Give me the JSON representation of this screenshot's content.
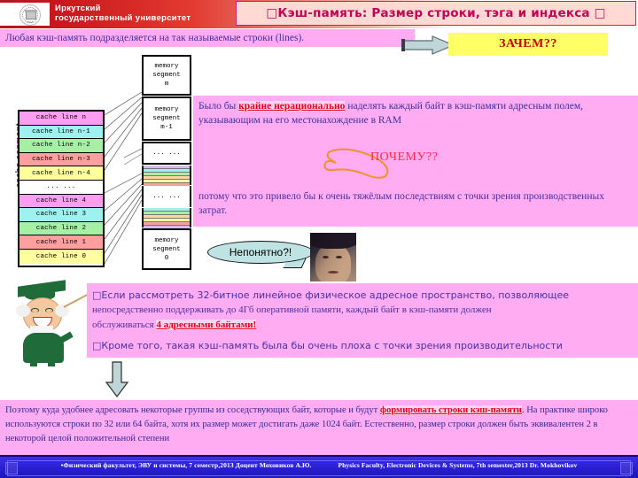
{
  "header": {
    "university_line1": "Иркутский",
    "university_line2": "государственный университет",
    "logo_year": "1918",
    "title": "□Кэш-память: Размер строки, тэга и индекса □"
  },
  "intro": {
    "text": "Любая кэш-память подразделяется на так называемые строки (lines)."
  },
  "callout_zachem": {
    "label": "ЗАЧЕМ??",
    "bg": "#ffff66",
    "fg": "#c0000a"
  },
  "cache_diagram": {
    "axis_label": "cache segment",
    "rows": [
      {
        "label": "cache line n",
        "color": "#ff9ef0"
      },
      {
        "label": "cache line n-1",
        "color": "#9ff1ef"
      },
      {
        "label": "cache line n-2",
        "color": "#a6f0a6"
      },
      {
        "label": "cache line n-3",
        "color": "#ff9f9f"
      },
      {
        "label": "cache line n-4",
        "color": "#ffff9e"
      },
      {
        "label": "... ...",
        "color": "#ffffff"
      },
      {
        "label": "cache line 4",
        "color": "#ff9ef0"
      },
      {
        "label": "cache line 3",
        "color": "#9ff1ef"
      },
      {
        "label": "cache line 2",
        "color": "#a6f0a6"
      },
      {
        "label": "cache line 1",
        "color": "#ff9f9f"
      },
      {
        "label": "cache line 0",
        "color": "#ffff9e"
      }
    ]
  },
  "memory_diagram": {
    "blocks": [
      {
        "lines": [
          "memory",
          "segment",
          "m"
        ]
      },
      {
        "lines": [
          "memory",
          "segment",
          "m-1"
        ]
      },
      {
        "lines": [
          "... ..."
        ]
      },
      {
        "lines": [
          "... ..."
        ]
      },
      {
        "lines": [
          "memory",
          "segment",
          "0"
        ]
      }
    ]
  },
  "para_irrational": {
    "before": "Было бы ",
    "highlight": "крайне нерационально",
    "after": " наделять каждый байт в кэш-памяти адресным полем, указывающим на его местонахождение в RAM"
  },
  "callout_why": {
    "label": "ПОЧЕМУ??",
    "color": "#ff2d4a"
  },
  "para_because": {
    "text": "потому что это привело бы к очень тяжёлым последствиям с точки зрения производственных затрат."
  },
  "callout_neponyatno": {
    "label": "Непонятно?!",
    "bg": "#bfe3e3"
  },
  "box3": {
    "line1": "□Если рассмотреть 32-битное линейное физическое адресное пространство, позволяющее",
    "line2": "непосредственно поддерживать до 4Гб оперативной памяти, каждый байт в кэш-памяти должен",
    "line3_before": "обслуживаться ",
    "line3_highlight": "4 адресными байтами!",
    "line4": "□Кроме того, такая кэш-память была бы очень плоха с точки зрения производительности"
  },
  "para_bottom": {
    "before": "Поэтому куда удобнее адресовать некоторые группы из соседствующих байт, которые и будут ",
    "highlight": "формировать строки кэш-памяти",
    "after": ". На практике широко используются строки по 32 или 64 байта, хотя их размер может достигать даже 1024 байт. Естественно, размер строки должен быть эквивалентен 2 в некоторой целой положительной степени"
  },
  "footer": {
    "left": "•Физический факультет, ЭВУ и системы, 7 семестр,2013 Доцент Моховиков А.Ю.",
    "right": "Physics Faculty, Electronic Devices & Systems, 7th semester,2013  Dr. Mokhovikov"
  }
}
